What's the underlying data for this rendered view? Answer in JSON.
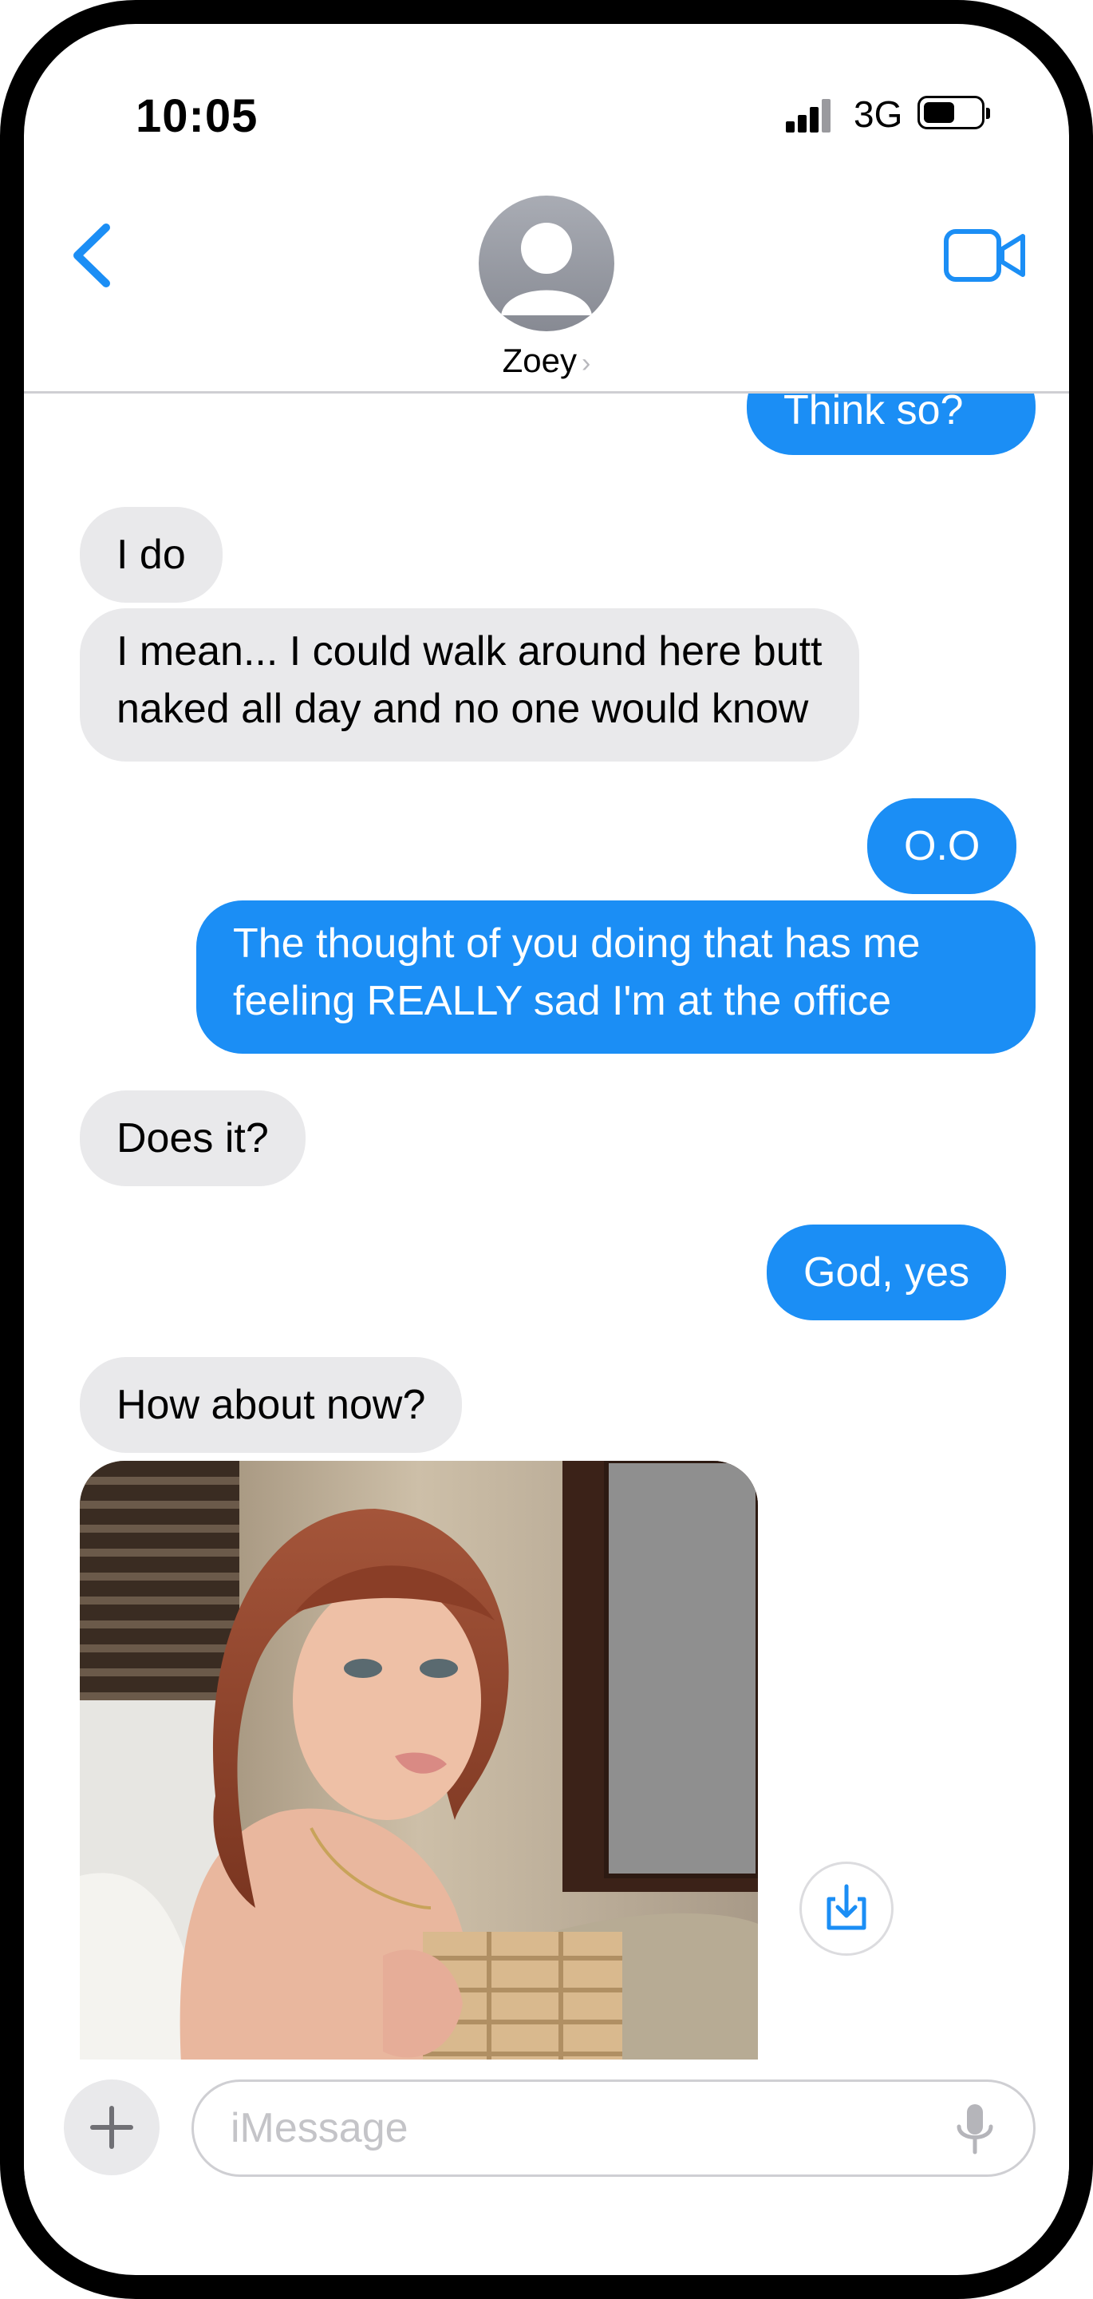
{
  "status_bar": {
    "time": "10:05",
    "network": "3G"
  },
  "header": {
    "contact_name": "Zoey",
    "chevron": "›"
  },
  "messages": [
    {
      "from": "me",
      "text": "Think so?"
    },
    {
      "from": "them",
      "text": "I do"
    },
    {
      "from": "them",
      "text": "I mean... I could walk around here butt\nnaked all day and no one would know"
    },
    {
      "from": "me",
      "text": "O.O"
    },
    {
      "from": "me",
      "text": "The thought of you doing that has me\nfeeling REALLY sad I'm at the office"
    },
    {
      "from": "them",
      "text": "Does it?"
    },
    {
      "from": "me",
      "text": "God, yes"
    },
    {
      "from": "them",
      "text": "How about now?"
    }
  ],
  "composer": {
    "placeholder": "iMessage"
  },
  "icons": {
    "back": "chevron-left-icon",
    "video": "video-camera-icon",
    "avatar": "person-icon",
    "save": "download-icon",
    "plus": "plus-icon",
    "mic": "microphone-icon"
  },
  "colors": {
    "accent": "#1b8ef5",
    "incoming_bubble": "#e9e9eb",
    "outgoing_bubble": "#1b8ef5",
    "separator": "#cfcfd3"
  }
}
